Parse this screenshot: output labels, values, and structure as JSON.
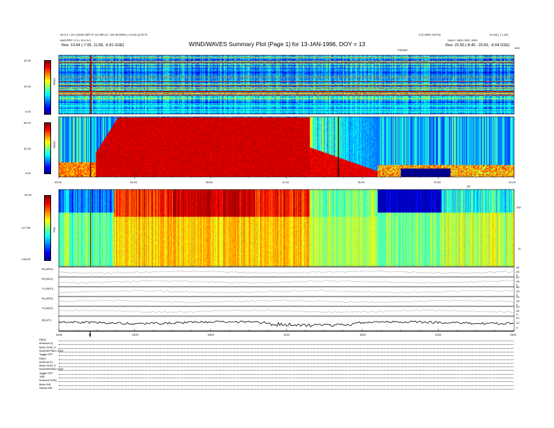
{
  "header": {
    "title": "WIND/WAVES Summary Plot (Page 1) for 13-JAN-1996, DOY = 13",
    "left_line1": "Wi 0.0 • 13.0 (2000 SEP 07 12:28P) (Y: 100.00 RMH) • 0:0:00 (2:00 P)",
    "left_line2": "ANG/PEP: 2.3 • 10.0 0.0",
    "left_res": "Res: 13.64 (-7.05, 11.58, -6.81 GSE)",
    "right_line1": "1:10 WED 25:P00",
    "right_line2": "0:0:00 | 1 | 100",
    "right_line3": "DAILY: WED 25/3, 2000",
    "right_res": "Res: 22.50 (-8.45, -20.81, -6.64 GSE)",
    "top_center": "TIS/AVE",
    "top_right": "kHz",
    "unit_right2": "GP"
  },
  "panels": {
    "rad2": {
      "label": "RAD2",
      "ticks": [
        "40.00",
        "20.00",
        "0.00"
      ]
    },
    "rad1": {
      "label": "RAD1",
      "ticks": [
        "60.00",
        "30.00",
        "0.00"
      ]
    },
    "tnr": {
      "label": "TNR",
      "ticks": [
        "-90.00",
        "-117.50",
        "-145.00"
      ],
      "right_ticks": [
        "100",
        "10"
      ]
    }
  },
  "time_axis": {
    "labels": [
      "00:00",
      "04:00",
      "08:00",
      "12:00",
      "16:00",
      "20:00",
      "24:00"
    ],
    "bottom_labels": [
      "0000",
      "0400",
      "0800",
      "1200",
      "1600",
      "2000",
      "2400"
    ],
    "marker": "M"
  },
  "line_panels": [
    {
      "label": "Bt (ADC)",
      "right": [
        "50",
        "25",
        "0"
      ]
    },
    {
      "label": "Bt (ADC)",
      "right": [
        "50",
        "25",
        "0"
      ]
    },
    {
      "label": "Ct (ADC)",
      "right": [
        "50",
        "25",
        "0"
      ]
    },
    {
      "label": "Bt (ADC)",
      "right": [
        "50",
        "25",
        "0"
      ]
    },
    {
      "label": "Vt (ADC)",
      "right": [
        "50",
        "25",
        "0"
      ]
    },
    {
      "label": "|B| (nT)",
      "right": [
        "20",
        "10",
        "0"
      ]
    }
  ],
  "footer": {
    "rows": [
      "RAD2",
      "Antenna   Ey",
      "Mode   SUM_S",
      "SUM/SEP/MIX   SUM",
      "Toggle   OFF",
      "RAD1",
      "Antenna   Ex",
      "Mode   SUM_S",
      "SUM/SEP/MIX   SUM",
      "Toggle   OFF",
      "TNR",
      "Antenna   Ex/Ey",
      "Mode   A/B",
      "Sweep   A/B"
    ]
  },
  "colors": {
    "jet": [
      "#00008f",
      "#0000ff",
      "#0080ff",
      "#00ffff",
      "#80ff80",
      "#ffff00",
      "#ff8000",
      "#ff0000",
      "#800000"
    ]
  },
  "chart_data": [
    {
      "type": "heatmap",
      "title": "RAD2",
      "x_range": [
        0,
        24
      ],
      "ylim": [
        0,
        40
      ],
      "colorbar": "jet"
    },
    {
      "type": "heatmap",
      "title": "RAD1",
      "x_range": [
        0,
        24
      ],
      "ylim": [
        0,
        60
      ],
      "colorbar": "jet"
    },
    {
      "type": "heatmap",
      "title": "TNR",
      "x_range": [
        0,
        24
      ],
      "ylim": [
        -145,
        -90
      ],
      "colorbar": "jet"
    }
  ]
}
